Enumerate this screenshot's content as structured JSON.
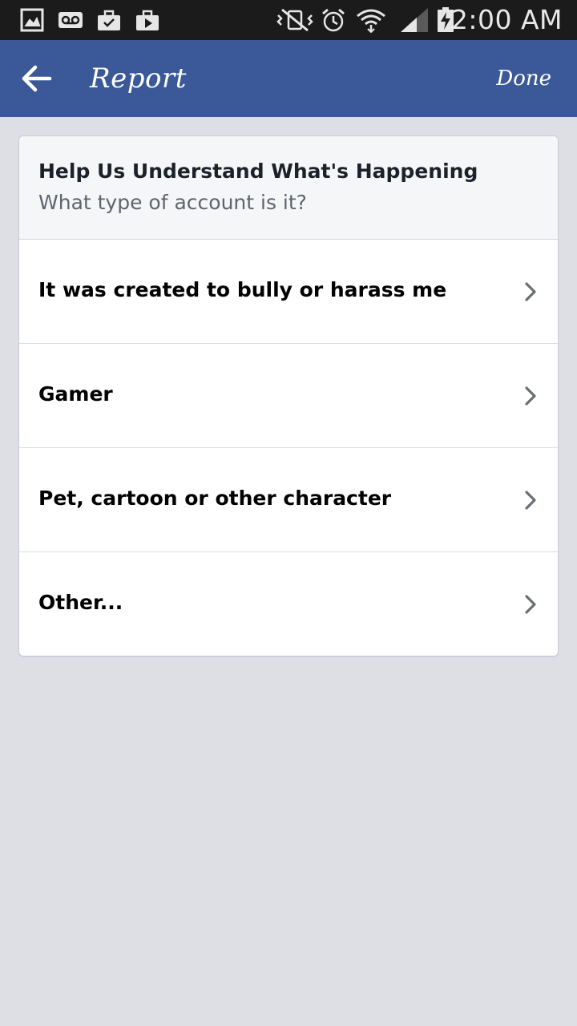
{
  "status_bar": {
    "time": "2:00 AM",
    "icons": [
      "gallery-icon",
      "voicemail-icon",
      "work-bag-icon",
      "play-store-icon",
      "vibrate-icon",
      "alarm-icon",
      "wifi-icon",
      "signal-icon",
      "battery-charging-icon"
    ]
  },
  "app_bar": {
    "title": "Report",
    "done_label": "Done",
    "background": "#3b5998"
  },
  "card": {
    "title": "Help Us Understand What's Happening",
    "subtitle": "What type of account is it?",
    "options": [
      {
        "label": "It was created to bully or harass me"
      },
      {
        "label": "Gamer"
      },
      {
        "label": "Pet, cartoon or other character"
      },
      {
        "label": "Other..."
      }
    ]
  }
}
